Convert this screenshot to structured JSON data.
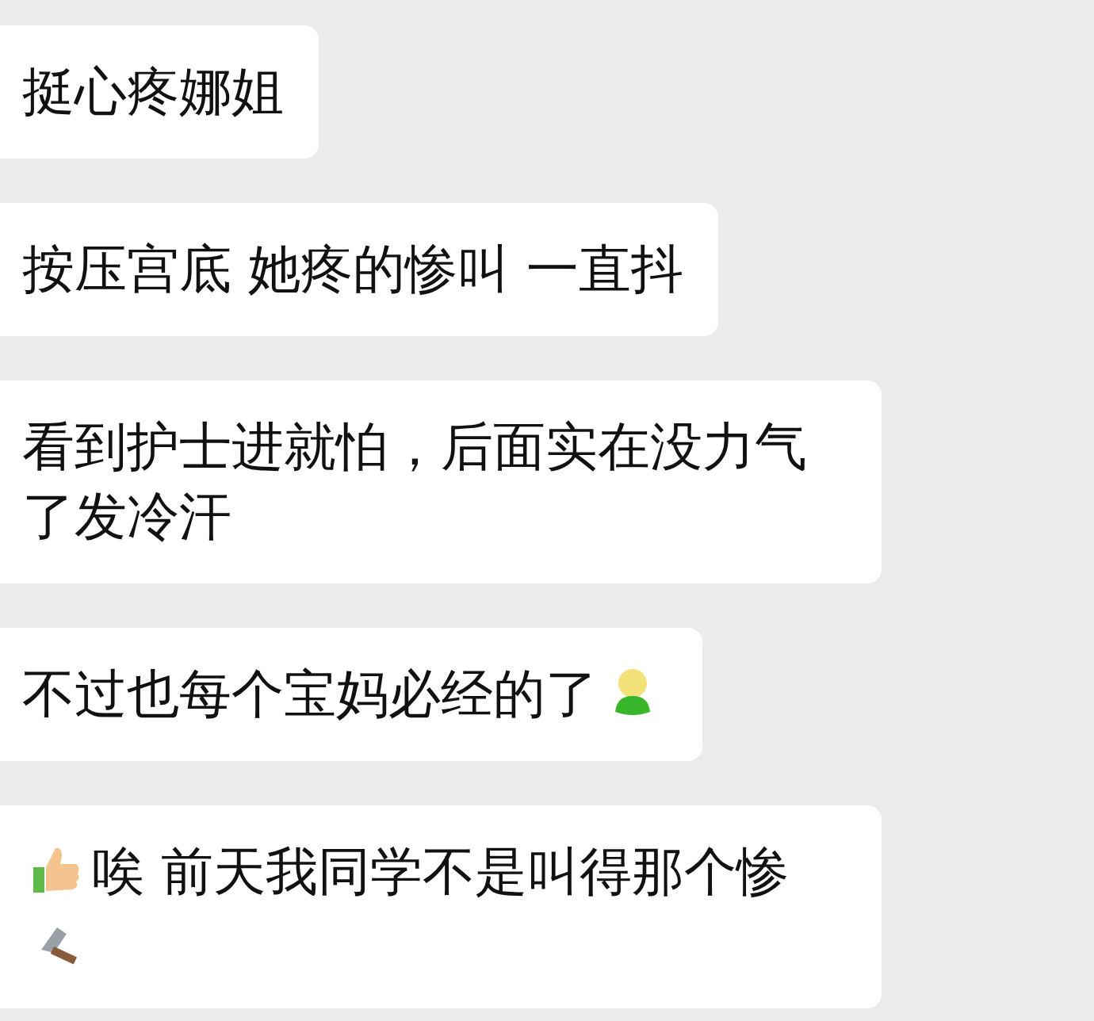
{
  "messages": [
    {
      "segments": [
        {
          "kind": "text",
          "text": "挺心疼娜姐"
        }
      ]
    },
    {
      "segments": [
        {
          "kind": "text",
          "text": "按压宫底 她疼的惨叫 一直抖"
        }
      ]
    },
    {
      "segments": [
        {
          "kind": "text",
          "text": "看到护士进就怕，后面实在没力气了发冷汗"
        }
      ]
    },
    {
      "segments": [
        {
          "kind": "text",
          "text": "不过也每个宝妈必经的了"
        },
        {
          "kind": "figure"
        }
      ]
    },
    {
      "segments": [
        {
          "kind": "thumb"
        },
        {
          "kind": "text",
          "text": "唉 前天我同学不是叫得那个惨"
        },
        {
          "kind": "hammer"
        }
      ]
    }
  ]
}
